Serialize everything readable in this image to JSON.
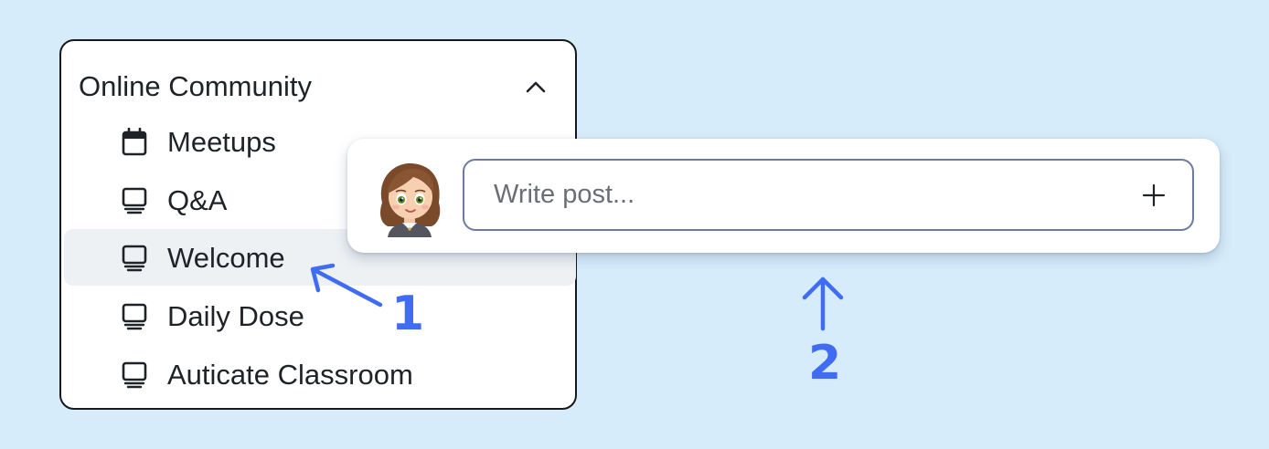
{
  "sidebar": {
    "section_title": "Online Community",
    "section_icon": "chevron-up-icon",
    "items": [
      {
        "label": "Meetups",
        "icon": "calendar-icon",
        "active": false
      },
      {
        "label": "Q&A",
        "icon": "monitor-icon",
        "active": false
      },
      {
        "label": "Welcome",
        "icon": "monitor-icon",
        "active": true
      },
      {
        "label": "Daily Dose",
        "icon": "monitor-icon",
        "active": false
      },
      {
        "label": "Auticate Classroom",
        "icon": "monitor-icon",
        "active": false
      }
    ]
  },
  "composer": {
    "avatar": "user-avatar",
    "placeholder": "Write post...",
    "add_icon": "plus-icon"
  },
  "annotations": {
    "step1": "1",
    "step2": "2",
    "color": "#3f6cf2"
  },
  "colors": {
    "background": "#d6ecfb",
    "active_item": "#edf1f4",
    "input_border": "#6e7aa3"
  }
}
